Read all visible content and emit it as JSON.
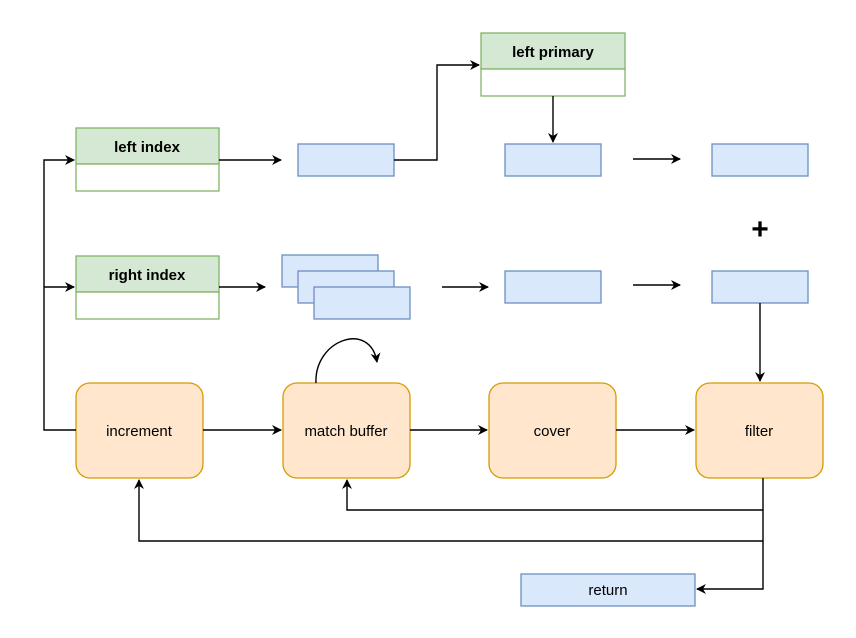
{
  "diagram": {
    "tables": [
      {
        "id": "left-primary",
        "title": "left primary"
      },
      {
        "id": "left-index",
        "title": "left index"
      },
      {
        "id": "right-index",
        "title": "right index"
      }
    ],
    "processes": [
      {
        "id": "increment",
        "label": "increment"
      },
      {
        "id": "match-buffer",
        "label": "match buffer"
      },
      {
        "id": "cover",
        "label": "cover"
      },
      {
        "id": "filter",
        "label": "filter"
      }
    ],
    "return_box": {
      "label": "return"
    },
    "operator": "+",
    "colors": {
      "table_header_fill": "#d5e8d4",
      "table_stroke": "#82b366",
      "data_fill": "#dae8fc",
      "data_stroke": "#6c8ebf",
      "process_fill": "#ffe6cc",
      "process_stroke": "#d79b00",
      "edge": "#000000"
    }
  }
}
